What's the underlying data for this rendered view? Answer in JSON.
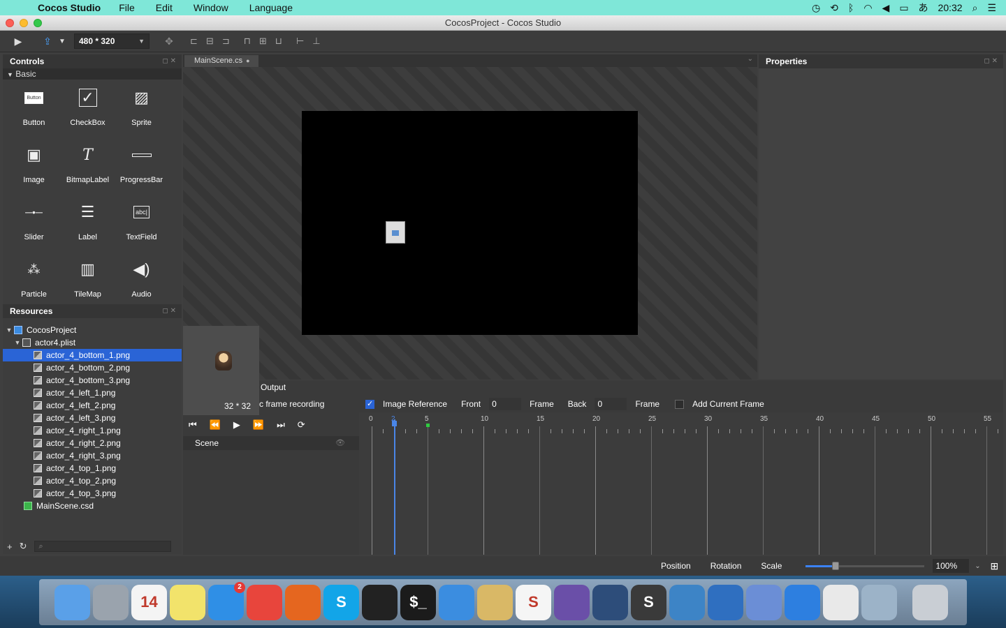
{
  "menubar": {
    "app_name": "Cocos Studio",
    "menus": [
      "File",
      "Edit",
      "Window",
      "Language"
    ],
    "clock": "20:32",
    "input_method": "あ"
  },
  "window": {
    "title": "CocosProject - Cocos Studio"
  },
  "toolbar": {
    "resolution": "480 * 320"
  },
  "controls_panel": {
    "title": "Controls",
    "category": "Basic",
    "items": [
      {
        "label": "Button",
        "icon": "button-icon"
      },
      {
        "label": "CheckBox",
        "icon": "checkbox-icon"
      },
      {
        "label": "Sprite",
        "icon": "sprite-icon"
      },
      {
        "label": "Image",
        "icon": "image-icon"
      },
      {
        "label": "BitmapLabel",
        "icon": "bitmap-label-icon"
      },
      {
        "label": "ProgressBar",
        "icon": "progressbar-icon"
      },
      {
        "label": "Slider",
        "icon": "slider-icon"
      },
      {
        "label": "Label",
        "icon": "label-icon"
      },
      {
        "label": "TextField",
        "icon": "textfield-icon"
      },
      {
        "label": "Particle",
        "icon": "particle-icon"
      },
      {
        "label": "TileMap",
        "icon": "tilemap-icon"
      },
      {
        "label": "Audio",
        "icon": "audio-icon"
      }
    ]
  },
  "resources_panel": {
    "title": "Resources",
    "project": "CocosProject",
    "plist": "actor4.plist",
    "files": [
      "actor_4_bottom_1.png",
      "actor_4_bottom_2.png",
      "actor_4_bottom_3.png",
      "actor_4_left_1.png",
      "actor_4_left_2.png",
      "actor_4_left_3.png",
      "actor_4_right_1.png",
      "actor_4_right_2.png",
      "actor_4_right_3.png",
      "actor_4_top_1.png",
      "actor_4_top_2.png",
      "actor_4_top_3.png"
    ],
    "selected_index": 0,
    "scene_file": "MainScene.csd"
  },
  "editor": {
    "tab_label": "MainScene.cs"
  },
  "properties_panel": {
    "title": "Properties"
  },
  "preview": {
    "size": "32 * 32"
  },
  "timeline": {
    "output_label": "Output",
    "recording_label": "c frame recording",
    "image_reference_label": "Image Reference",
    "image_reference_checked": true,
    "front_label": "Front",
    "front_value": "0",
    "frame_label": "Frame",
    "back_label": "Back",
    "back_value": "0",
    "frame_label_2": "Frame",
    "add_current_frame_label": "Add Current Frame",
    "add_current_frame_checked": false,
    "scene_label": "Scene",
    "ruler_labels": [
      "0",
      "2",
      "5",
      "10",
      "15",
      "20",
      "25",
      "30",
      "35",
      "40",
      "45",
      "50",
      "55"
    ],
    "current_frame": 2
  },
  "statusbar": {
    "tabs": [
      "Position",
      "Rotation",
      "Scale"
    ],
    "zoom": "100%",
    "zoom_slider_level": 0.25
  },
  "dock": {
    "apps": [
      {
        "name": "Finder",
        "icon": "finder-icon",
        "color": "#5aa0e8"
      },
      {
        "name": "Launchpad",
        "icon": "launchpad-icon",
        "color": "#9aa3ad"
      },
      {
        "name": "Calendar",
        "icon": "calendar-icon",
        "color": "#f4f4f4",
        "text": "14"
      },
      {
        "name": "Stickies",
        "icon": "notes-icon",
        "color": "#f2e36b"
      },
      {
        "name": "App Store",
        "icon": "appstore-icon",
        "color": "#2f8fe6",
        "badge": "2"
      },
      {
        "name": "Chrome",
        "icon": "chrome-icon",
        "color": "#e8453c"
      },
      {
        "name": "Firefox",
        "icon": "firefox-icon",
        "color": "#e5661f"
      },
      {
        "name": "Skype",
        "icon": "skype-icon",
        "color": "#12a5e8",
        "text": "S"
      },
      {
        "name": "Unity",
        "icon": "unity-icon",
        "color": "#222222"
      },
      {
        "name": "Terminal",
        "icon": "terminal-icon",
        "color": "#1b1b1b",
        "text": "$_"
      },
      {
        "name": "Xcode",
        "icon": "xcode-icon",
        "color": "#3b8de0"
      },
      {
        "name": "Sequel",
        "icon": "database-icon",
        "color": "#d9b866"
      },
      {
        "name": "Slack",
        "icon": "slack-icon",
        "color": "#f5f5f5",
        "text": "S"
      },
      {
        "name": "Eclipse",
        "icon": "eclipse-icon",
        "color": "#6a4fa8"
      },
      {
        "name": "SourceTree",
        "icon": "sourcetree-icon",
        "color": "#2d4d7a"
      },
      {
        "name": "Sublime",
        "icon": "sublime-icon",
        "color": "#3a3a3a",
        "text": "S"
      },
      {
        "name": "Cocos",
        "icon": "cocos-icon",
        "color": "#3d84c6"
      },
      {
        "name": "Cocos Studio",
        "icon": "cocos-studio-icon",
        "color": "#2f6fc0"
      },
      {
        "name": "Keynote",
        "icon": "keynote-icon",
        "color": "#6b8ed6"
      },
      {
        "name": "iTunes",
        "icon": "itunes-icon",
        "color": "#2d7fe0"
      },
      {
        "name": "TextEdit",
        "icon": "textedit-icon",
        "color": "#e9e9e9"
      },
      {
        "name": "Preview",
        "icon": "preview-icon",
        "color": "#9cb3c8"
      },
      {
        "name": "Trash",
        "icon": "trash-icon",
        "color": "#c9ced4"
      }
    ]
  }
}
